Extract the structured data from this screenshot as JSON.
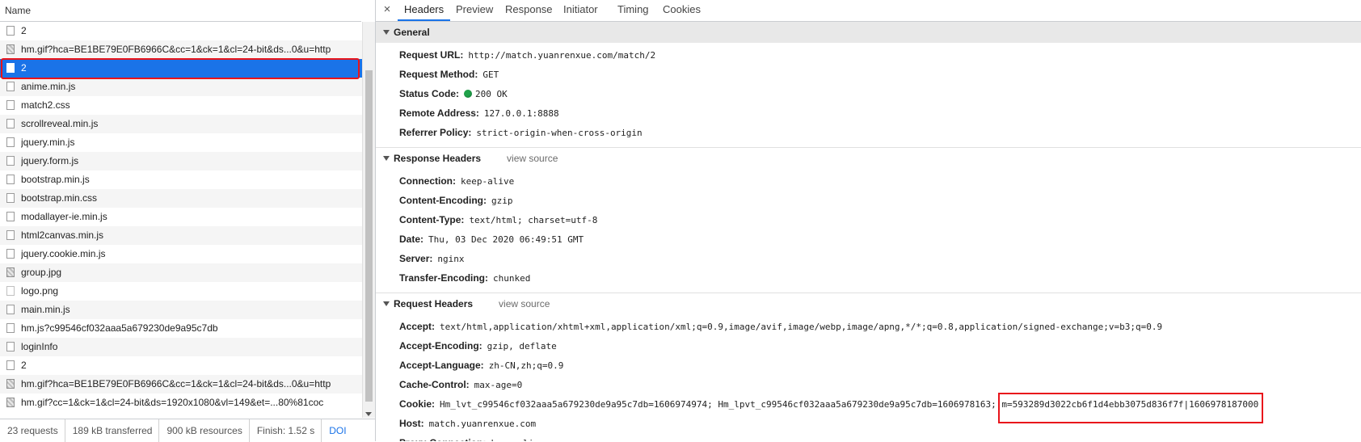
{
  "request_list": {
    "header": "Name",
    "rows": [
      {
        "name": "2",
        "icon": "document-icon",
        "kind": "doc"
      },
      {
        "name": "hm.gif?hca=BE1BE79E0FB6966C&cc=1&ck=1&cl=24-bit&ds...0&u=http",
        "icon": "image-icon",
        "kind": "img"
      },
      {
        "name": "2",
        "icon": "document-icon",
        "kind": "doc",
        "selected": true
      },
      {
        "name": "anime.min.js",
        "icon": "document-icon",
        "kind": "doc"
      },
      {
        "name": "match2.css",
        "icon": "document-icon",
        "kind": "doc"
      },
      {
        "name": "scrollreveal.min.js",
        "icon": "document-icon",
        "kind": "doc"
      },
      {
        "name": "jquery.min.js",
        "icon": "document-icon",
        "kind": "doc"
      },
      {
        "name": "jquery.form.js",
        "icon": "document-icon",
        "kind": "doc"
      },
      {
        "name": "bootstrap.min.js",
        "icon": "document-icon",
        "kind": "doc"
      },
      {
        "name": "bootstrap.min.css",
        "icon": "document-icon",
        "kind": "doc"
      },
      {
        "name": "modallayer-ie.min.js",
        "icon": "document-icon",
        "kind": "doc"
      },
      {
        "name": "html2canvas.min.js",
        "icon": "document-icon",
        "kind": "doc"
      },
      {
        "name": "jquery.cookie.min.js",
        "icon": "document-icon",
        "kind": "doc"
      },
      {
        "name": "group.jpg",
        "icon": "image-icon",
        "kind": "img"
      },
      {
        "name": "logo.png",
        "icon": "png-icon",
        "kind": "png"
      },
      {
        "name": "main.min.js",
        "icon": "document-icon",
        "kind": "doc"
      },
      {
        "name": "hm.js?c99546cf032aaa5a679230de9a95c7db",
        "icon": "document-icon",
        "kind": "doc"
      },
      {
        "name": "loginInfo",
        "icon": "document-icon",
        "kind": "doc"
      },
      {
        "name": "2",
        "icon": "document-icon",
        "kind": "doc"
      },
      {
        "name": "hm.gif?hca=BE1BE79E0FB6966C&cc=1&ck=1&cl=24-bit&ds...0&u=http",
        "icon": "image-icon",
        "kind": "img"
      },
      {
        "name": "hm.gif?cc=1&ck=1&cl=24-bit&ds=1920x1080&vl=149&et=...80%81coc",
        "icon": "image-icon",
        "kind": "img"
      }
    ]
  },
  "status_bar": {
    "requests": "23 requests",
    "transferred": "189 kB transferred",
    "resources": "900 kB resources",
    "finish": "Finish: 1.52 s",
    "dom": "DOI"
  },
  "tabs": [
    "Headers",
    "Preview",
    "Response",
    "Initiator",
    "Timing",
    "Cookies"
  ],
  "active_tab": "Headers",
  "close_label": "×",
  "general": {
    "title": "General",
    "rows": [
      {
        "key": "Request URL:",
        "value": "http://match.yuanrenxue.com/match/2"
      },
      {
        "key": "Request Method:",
        "value": "GET"
      },
      {
        "key": "Status Code:",
        "value": "200 OK",
        "dot": true
      },
      {
        "key": "Remote Address:",
        "value": "127.0.0.1:8888"
      },
      {
        "key": "Referrer Policy:",
        "value": "strict-origin-when-cross-origin"
      }
    ]
  },
  "response_headers": {
    "title": "Response Headers",
    "view_source": "view source",
    "rows": [
      {
        "key": "Connection:",
        "value": "keep-alive"
      },
      {
        "key": "Content-Encoding:",
        "value": "gzip"
      },
      {
        "key": "Content-Type:",
        "value": "text/html; charset=utf-8"
      },
      {
        "key": "Date:",
        "value": "Thu, 03 Dec 2020 06:49:51 GMT"
      },
      {
        "key": "Server:",
        "value": "nginx"
      },
      {
        "key": "Transfer-Encoding:",
        "value": "chunked"
      }
    ]
  },
  "request_headers": {
    "title": "Request Headers",
    "view_source": "view source",
    "rows": [
      {
        "key": "Accept:",
        "value": "text/html,application/xhtml+xml,application/xml;q=0.9,image/avif,image/webp,image/apng,*/*;q=0.8,application/signed-exchange;v=b3;q=0.9"
      },
      {
        "key": "Accept-Encoding:",
        "value": "gzip, deflate"
      },
      {
        "key": "Accept-Language:",
        "value": "zh-CN,zh;q=0.9"
      },
      {
        "key": "Cache-Control:",
        "value": "max-age=0"
      },
      {
        "key": "Cookie:",
        "value": "Hm_lvt_c99546cf032aaa5a679230de9a95c7db=1606974974; Hm_lpvt_c99546cf032aaa5a679230de9a95c7db=1606978163; ",
        "highlight": "m=593289d3022cb6f1d4ebb3075d836f7f|1606978187000"
      },
      {
        "key": "Host:",
        "value": "match.yuanrenxue.com"
      },
      {
        "key": "Proxy-Connection:",
        "value": "keep-alive"
      }
    ]
  },
  "colors": {
    "selection": "#1a73e8",
    "annotation": "#e8141b",
    "status_ok": "#1fa24a"
  }
}
